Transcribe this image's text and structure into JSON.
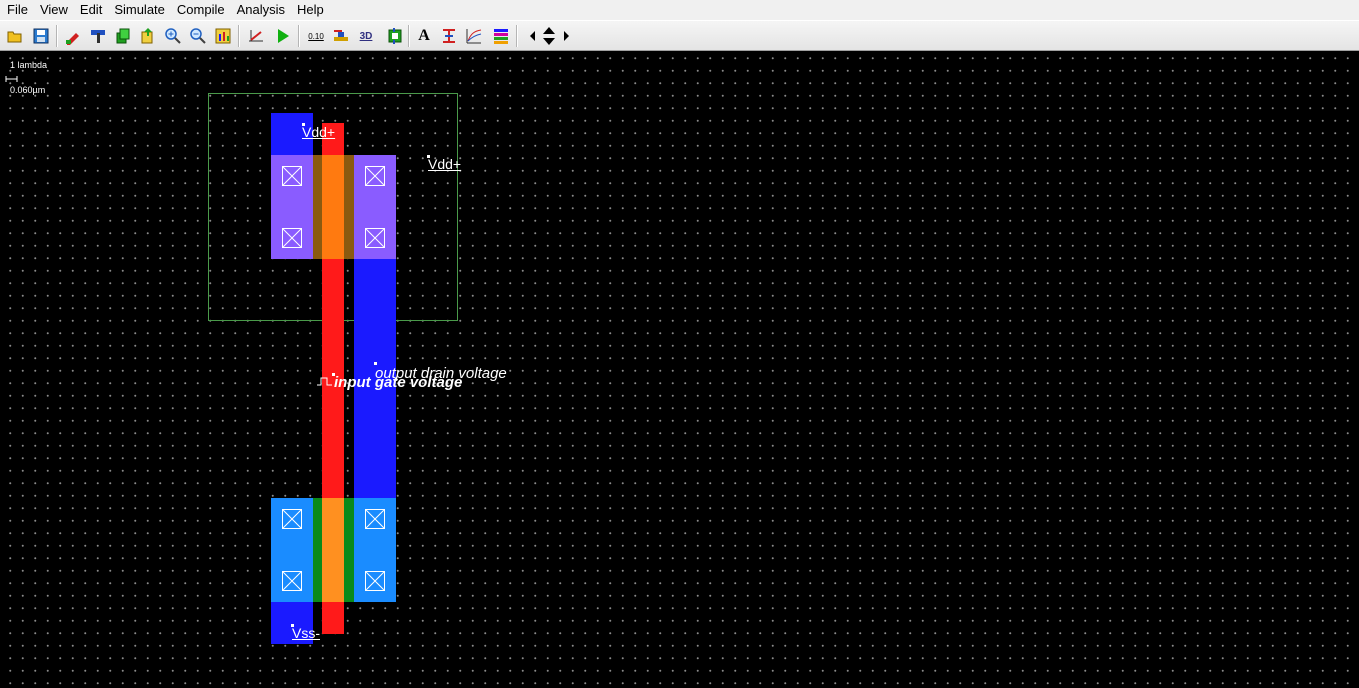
{
  "menu": [
    "File",
    "View",
    "Edit",
    "Simulate",
    "Compile",
    "Analysis",
    "Help"
  ],
  "toolbar": {
    "tools": [
      {
        "name": "open-icon",
        "color": "#e0b000"
      },
      {
        "name": "save-icon",
        "color": "#2a7bd0"
      },
      {
        "name": "edit-layer-icon",
        "color": "#d02020"
      },
      {
        "name": "connection-icon",
        "color": "#2050c0"
      },
      {
        "name": "copy-icon",
        "color": "#20a020"
      },
      {
        "name": "move-icon",
        "color": "#20a020"
      },
      {
        "name": "zoom-in-icon",
        "color": "#2060c0"
      },
      {
        "name": "zoom-out-icon",
        "color": "#2060c0"
      },
      {
        "name": "view-all-icon",
        "color": "#d0a000"
      },
      {
        "name": "measure-icon",
        "color": "#d02020"
      },
      {
        "name": "run-simulation-icon",
        "color": "#10b010"
      },
      {
        "name": "design-rules-icon",
        "color": "#303030"
      },
      {
        "name": "cross-section-icon",
        "color": "#d0a000"
      },
      {
        "name": "3d-view-icon",
        "color": "#303080"
      },
      {
        "name": "mos-generator-icon",
        "color": "#208020"
      },
      {
        "name": "text-icon",
        "color": "#000000"
      },
      {
        "name": "interconnect-icon",
        "color": "#d02020"
      },
      {
        "name": "analysis-chart-icon",
        "color": "#d02020"
      },
      {
        "name": "layers-icon",
        "color": "#d000a0"
      },
      {
        "name": "arrow-left-icon",
        "color": "#000000"
      },
      {
        "name": "arrow-up-down-icon",
        "color": "#000000"
      },
      {
        "name": "arrow-right-icon",
        "color": "#000000"
      }
    ],
    "tool_text": {
      "design_rules": "0.10",
      "three_d": "3D"
    }
  },
  "scale": {
    "lambda": "1 lambda",
    "size": "0.060µm"
  },
  "labels": {
    "vdd_top": "Vdd+",
    "vdd_right": "Vdd+",
    "output": "output drain voltage",
    "input": "input gate voltage",
    "vss": "Vss-"
  },
  "colors": {
    "nwell_border": "#4a9a4a",
    "pmos_diffusion": "#8a5cff",
    "nmos_diffusion": "#1a8cff",
    "metal": "#1a1aff",
    "poly": "#ff1a1a",
    "gate_channel_p": "#ff7a10",
    "gate_channel_n": "#ff9020",
    "diffusion_edge_n": "#0a8a1a",
    "diffusion_edge_p": "#8a5a10"
  }
}
